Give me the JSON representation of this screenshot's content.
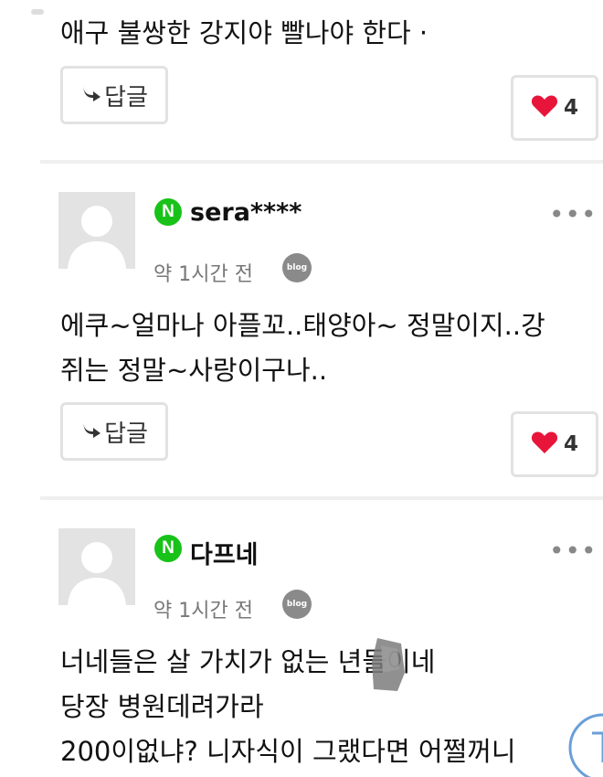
{
  "comments": [
    {
      "text_lines": [
        "애구 불쌍한 강지야 빨나야 한다  ·"
      ],
      "reply_label": "답글",
      "likes": "4"
    },
    {
      "nickname": "sera****",
      "time": "약 1시간 전",
      "text_lines": [
        "에쿠~얼마나 아플꼬..태양아~ 정말이지..강",
        "쥐는 정말~사랑이구나.."
      ],
      "reply_label": "답글",
      "likes": "4"
    },
    {
      "nickname": "다프네",
      "time": "약 1시간 전",
      "text_lines": [
        "너네들은 살  가치가 없는 년들이네",
        "당장 병원데려가라",
        "200이없냐? 니자식이 그랬다면  어쩔꺼니"
      ]
    }
  ],
  "badge_letter": "N",
  "blog_label": "blog",
  "more_label": "•••",
  "colors": {
    "heart": "#e8153b",
    "naver_green": "#19c219",
    "border": "#e2e2e2"
  },
  "icons": [
    "reply-arrow-icon",
    "heart-icon",
    "naver-badge-icon",
    "blog-icon",
    "more-options-icon",
    "scroll-top-icon"
  ]
}
